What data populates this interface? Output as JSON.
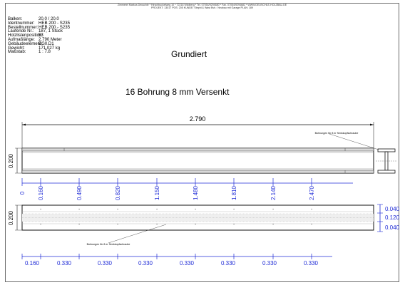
{
  "header": {
    "line1": "Zimmerei Markus Deuschle * Hirschbuckelweg 10 * 72218 Wildberg * Tel. 07054/9294680 * Fax. 07054/9294682 * WWW.DEUSCHLE-HOLZBAU.DE",
    "line2": "PROJEKT: 13017   POS: 205   KUNDE: Stephi & Wast   Bvh.: Neubau mit Garage   PLAN: 189"
  },
  "meta": [
    {
      "label": "Balken:",
      "value": "20.0 / 20.0"
    },
    {
      "label": "Identnummer:",
      "value": "HEB 200 - S235"
    },
    {
      "label": "Bestellnummer:",
      "value": "HEB 200 - S235"
    },
    {
      "label": "Laufende Nr.:",
      "value": "187, 1 Stück"
    },
    {
      "label": "Holzlistenposition:",
      "value": "53"
    },
    {
      "label": "Aufmaßlänge:",
      "value": "2.790 Meter"
    },
    {
      "label": "Gebäudeelement:",
      "value": "EG0.D1"
    },
    {
      "label": "Gewicht:",
      "value": "171.027 kg"
    },
    {
      "label": "Maßstab:",
      "value": "1 : 7.8"
    }
  ],
  "titles": {
    "finish": "Grundiert",
    "drilling": "16 Bohrung 8 mm Versenkt"
  },
  "dims": {
    "overall": "2.790",
    "side_height": "0.200",
    "top_height": "0.200",
    "ordinates": [
      "0",
      "0.160",
      "0.490",
      "0.820",
      "1.150",
      "1.480",
      "1.810",
      "2.140",
      "2.470"
    ],
    "spacing": [
      "0.160",
      "0.330",
      "0.330",
      "0.330",
      "0.330",
      "0.330",
      "0.330",
      "0.330"
    ],
    "right": [
      "0.040",
      "0.120",
      "0.040"
    ]
  },
  "notes": {
    "callout_top": "Bohrungen für 8 er Senkkopfschraube",
    "callout_bottom": "Bohrungen für 8 er Senkkopfschraube"
  },
  "colors": {
    "dimension": "#1f2bd6",
    "outline": "#111111"
  }
}
